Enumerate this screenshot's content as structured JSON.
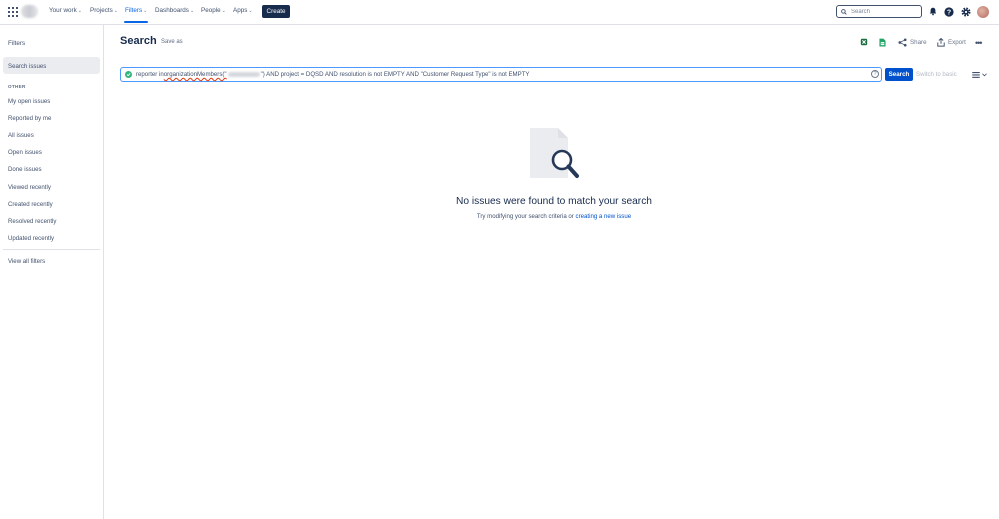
{
  "nav": {
    "items": [
      {
        "label": "Your work"
      },
      {
        "label": "Projects"
      },
      {
        "label": "Filters"
      },
      {
        "label": "Dashboards"
      },
      {
        "label": "People"
      },
      {
        "label": "Apps"
      }
    ],
    "create_label": "Create",
    "search_placeholder": "Search",
    "icons": [
      "app-switcher-icon",
      "notification-bell-icon",
      "help-icon",
      "settings-gear-icon"
    ]
  },
  "sidebar": {
    "title": "Filters",
    "active_item": "Search issues",
    "heading": "OTHER",
    "items": [
      "My open issues",
      "Reported by me",
      "All issues",
      "Open issues",
      "Done issues",
      "Viewed recently",
      "Created recently",
      "Resolved recently",
      "Updated recently"
    ],
    "view_all": "View all filters"
  },
  "main": {
    "title": "Search",
    "save_as": "Save as",
    "share": "Share",
    "export": "Export",
    "jql": {
      "part1": "reporter in ",
      "func": "organizationMembers(\"",
      "part2": "\") AND project = DQSD AND resolution is not EMPTY AND \"Customer Request Type\" is not EMPTY"
    },
    "search_button": "Search",
    "switch_basic": "Switch to basic",
    "empty": {
      "title": "No issues were found to match your search",
      "sub_prefix": "Try modifying your search criteria or ",
      "link": "creating a new issue"
    }
  },
  "colors": {
    "brand": "#0052cc",
    "active_nav": "#0c66e4",
    "valid": "#36b37e",
    "create_bg": "#172b4d"
  }
}
